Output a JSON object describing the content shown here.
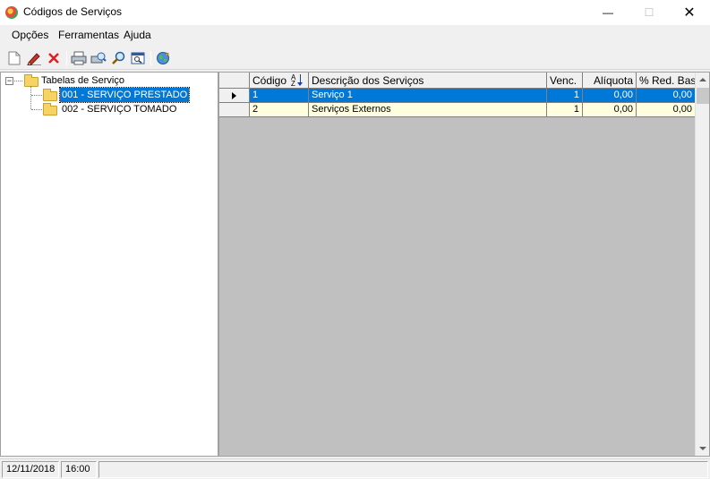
{
  "window": {
    "title": "Códigos de Serviços",
    "minimize_glyph": "—",
    "maximize_glyph": "☐",
    "close_glyph": "✕"
  },
  "menu": {
    "items": [
      {
        "label": "Opções"
      },
      {
        "label": "Ferramentas"
      },
      {
        "label": "Ajuda"
      }
    ]
  },
  "toolbar": {
    "buttons": [
      {
        "icon": "new-document-icon"
      },
      {
        "icon": "edit-pencil-icon"
      },
      {
        "icon": "delete-x-icon"
      },
      {
        "icon": "print-icon"
      },
      {
        "icon": "print-preview-icon"
      },
      {
        "icon": "search-icon"
      },
      {
        "icon": "zoom-window-icon"
      },
      {
        "icon": "globe-icon"
      }
    ]
  },
  "tree": {
    "root_label": "Tabelas de Serviço",
    "expander_glyph": "−",
    "children": [
      {
        "label": "001 - SERVIÇO PRESTADO",
        "selected": true
      },
      {
        "label": "002 - SERVIÇO TOMADO",
        "selected": false
      }
    ]
  },
  "grid": {
    "sort_glyph": "A\nZ",
    "columns": [
      {
        "label": "Código"
      },
      {
        "label": "Descrição dos Serviços"
      },
      {
        "label": "Venc."
      },
      {
        "label": "Alíquota"
      },
      {
        "label": "% Red. Base"
      }
    ],
    "rows": [
      {
        "codigo": "1",
        "descricao": "Serviço 1",
        "venc": "1",
        "aliquota": "0,00",
        "red_base": "0,00",
        "selected": true
      },
      {
        "codigo": "2",
        "descricao": "Serviços Externos",
        "venc": "1",
        "aliquota": "0,00",
        "red_base": "0,00",
        "selected": false
      }
    ]
  },
  "status": {
    "date": "12/11/2018",
    "time": "16:00",
    "message": ""
  },
  "colors": {
    "selection": "#0078d7",
    "alt_row": "#ffffe0",
    "grid_empty": "#c0c0c0"
  }
}
